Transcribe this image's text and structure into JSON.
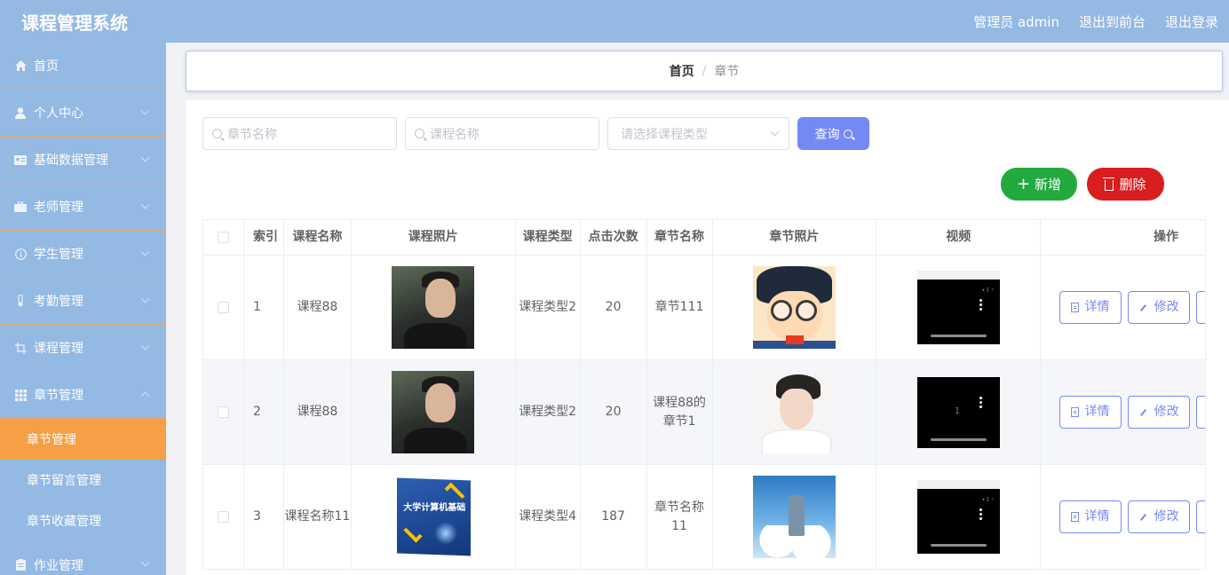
{
  "app": {
    "title": "课程管理系统"
  },
  "topbar": {
    "admin": "管理员 admin",
    "to_front": "退出到前台",
    "logout": "退出登录"
  },
  "sidebar": {
    "items": [
      {
        "label": "首页",
        "icon": "home-icon"
      },
      {
        "label": "个人中心",
        "icon": "user-icon"
      },
      {
        "label": "基础数据管理",
        "icon": "id-card-icon"
      },
      {
        "label": "老师管理",
        "icon": "briefcase-icon"
      },
      {
        "label": "学生管理",
        "icon": "info-icon"
      },
      {
        "label": "考勤管理",
        "icon": "thermometer-icon"
      },
      {
        "label": "课程管理",
        "icon": "crop-icon"
      },
      {
        "label": "章节管理",
        "icon": "grid-icon"
      }
    ],
    "sub_items": [
      {
        "label": "章节管理",
        "active": true
      },
      {
        "label": "章节留言管理",
        "active": false
      },
      {
        "label": "章节收藏管理",
        "active": false
      }
    ],
    "last_item": {
      "label": "作业管理",
      "icon": "clipboard-icon"
    }
  },
  "breadcrumb": {
    "home": "首页",
    "separator": "/",
    "current": "章节"
  },
  "search": {
    "chapter_placeholder": "章节名称",
    "course_placeholder": "课程名称",
    "type_placeholder": "请选择课程类型",
    "query_label": "查询"
  },
  "actions": {
    "add_label": "新增",
    "delete_label": "删除"
  },
  "table": {
    "columns": [
      "索引",
      "课程名称",
      "课程照片",
      "课程类型",
      "点击次数",
      "章节名称",
      "章节照片",
      "视频",
      "操作"
    ],
    "rows": [
      {
        "index": "1",
        "course_name": "课程88",
        "course_type": "课程类型2",
        "clicks": "20",
        "chapter_name": "章节111",
        "course_photo": "photo-man",
        "chapter_photo": "photo-conan",
        "video_counter": ""
      },
      {
        "index": "2",
        "course_name": "课程88",
        "course_type": "课程类型2",
        "clicks": "20",
        "chapter_name": "课程88的章节1",
        "course_photo": "photo-man",
        "chapter_photo": "photo-boy",
        "video_counter": "1"
      },
      {
        "index": "3",
        "course_name": "课程名称11",
        "course_type": "课程类型4",
        "clicks": "187",
        "chapter_name": "章节名称11",
        "course_photo": "photo-book",
        "chapter_photo": "photo-sky",
        "video_counter": ""
      }
    ],
    "book_cover_title": "大学计算机基础",
    "detail_label": "详情",
    "edit_label": "修改"
  },
  "colors": {
    "sidebar_bg": "#94b9e3",
    "active_orange": "#f69f46",
    "primary": "#7589f6",
    "add_green": "#22aa3e",
    "delete_red": "#d81e1e"
  }
}
